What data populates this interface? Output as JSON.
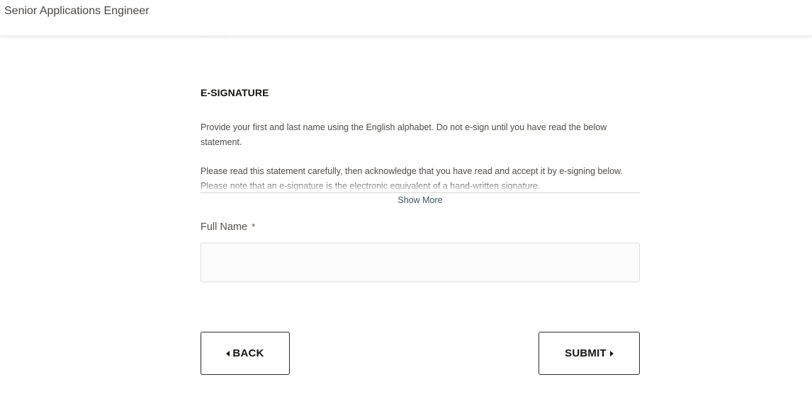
{
  "header": {
    "job_title": "Senior Applications Engineer"
  },
  "esignature": {
    "section_title": "E-SIGNATURE",
    "instruction": "Provide your first and last name using the English alphabet. Do not e-sign until you have read the below statement.",
    "statement": "Please read this statement carefully, then acknowledge that you have read and accept it by e-signing below. Please note that an e-signature is the electronic equivalent of a hand-written signature.",
    "show_more_label": "Show More",
    "full_name_label": "Full Name",
    "required_marker": "*",
    "full_name_value": "",
    "full_name_placeholder": ""
  },
  "actions": {
    "back_label": "BACK",
    "submit_label": "SUBMIT"
  },
  "icons": {
    "back": "caret-left-icon",
    "submit": "caret-right-icon"
  },
  "colors": {
    "button_border": "#312d2a",
    "link": "#3a5766",
    "input_background": "#fcfcfc"
  }
}
